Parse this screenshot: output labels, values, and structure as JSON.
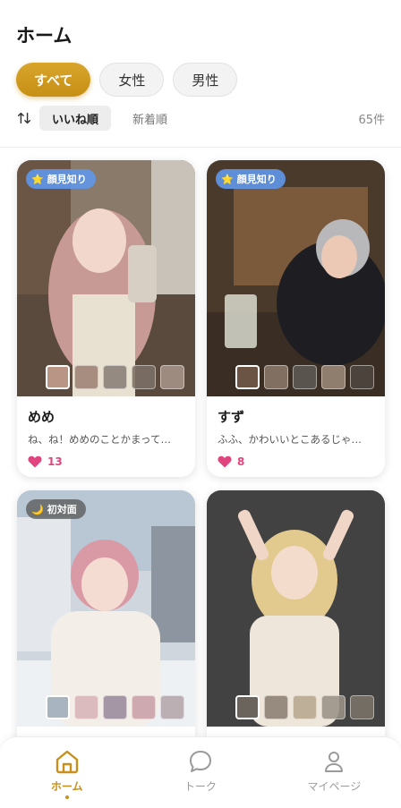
{
  "header": {
    "title": "ホーム"
  },
  "filters": [
    {
      "label": "すべて",
      "active": true
    },
    {
      "label": "女性",
      "active": false
    },
    {
      "label": "男性",
      "active": false
    }
  ],
  "sort": {
    "active_label": "いいね順",
    "alt_label": "新着順",
    "count": "65件"
  },
  "cards": [
    {
      "badge": "顔見知り",
      "badge_icon": "star-icon",
      "name": "めめ",
      "message": "ね、ね！めめのことかまって…",
      "likes": "13",
      "thumbnail_count": 5,
      "selected_thumbnail": 1
    },
    {
      "badge": "顔見知り",
      "badge_icon": "star-icon",
      "name": "すず",
      "message": "ふふ、かわいいとこあるじゃ…",
      "likes": "8",
      "thumbnail_count": 5,
      "selected_thumbnail": 1
    },
    {
      "badge": "初対面",
      "badge_icon": "moon-icon",
      "name": "",
      "message": "",
      "likes": "",
      "thumbnail_count": 5,
      "selected_thumbnail": 1
    },
    {
      "badge": "",
      "badge_icon": "",
      "name": "",
      "message": "",
      "likes": "",
      "thumbnail_count": 5,
      "selected_thumbnail": 1
    }
  ],
  "nav": [
    {
      "label": "ホーム",
      "icon": "home-icon",
      "active": true
    },
    {
      "label": "トーク",
      "icon": "chat-bubble-icon",
      "active": false
    },
    {
      "label": "マイページ",
      "icon": "person-icon",
      "active": false
    }
  ],
  "colors": {
    "accent": "#c8901a",
    "like": "#e0457f",
    "badge_blue": "#6096e6"
  }
}
